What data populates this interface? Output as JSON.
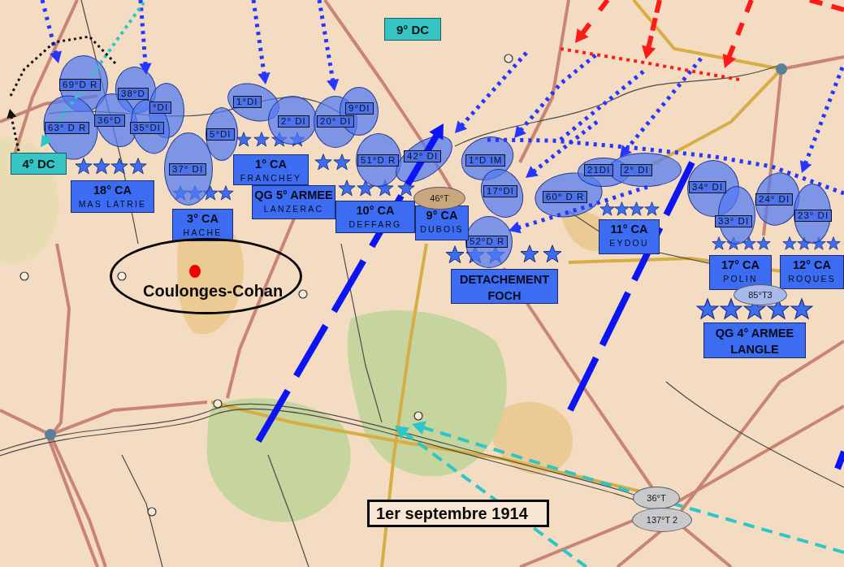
{
  "divisions": [
    "69°D R",
    "63° D R",
    "38°D",
    "36°D",
    "°DI",
    "35°DI",
    "5°DI",
    "37° DI",
    "1°DI",
    "2° DI",
    "20° DI",
    "9°DI",
    "51°D R",
    "42° DI",
    "1°D IM",
    "17°DI",
    "60° D R",
    "21DI",
    "2° DI",
    "34° DI",
    "33° DI",
    "24° DI",
    "23° DI",
    "52°D R"
  ],
  "cavalry": [
    "4° DC",
    "9° DC"
  ],
  "corps": [
    {
      "kind": "corps",
      "name": "18° CA",
      "commander": "MAS LATRIE"
    },
    {
      "kind": "corps",
      "name": "3° CA",
      "commander": "HACHE"
    },
    {
      "kind": "corps",
      "name": "1° CA",
      "commander": "FRANCHEY"
    },
    {
      "kind": "corps",
      "name": "QG 5° ARMEE",
      "commander": "LANZERAC"
    },
    {
      "kind": "corps",
      "name": "10° CA",
      "commander": "DEFFARG"
    },
    {
      "kind": "corps",
      "name": "9° CA",
      "commander": "DUBOIS"
    },
    {
      "kind": "command",
      "name": "DETACHEMENT",
      "commander": "FOCH"
    },
    {
      "kind": "corps",
      "name": "11° CA",
      "commander": "EYDOU"
    },
    {
      "kind": "corps",
      "name": "17° CA",
      "commander": "POLIN"
    },
    {
      "kind": "corps",
      "name": "12° CA",
      "commander": "ROQUES"
    },
    {
      "kind": "command",
      "name": "QG 4° ARMEE",
      "commander": "LANGLE"
    }
  ],
  "territorials": [
    {
      "label": "46°T",
      "color": "#c8a77c"
    },
    {
      "label": "85°T3",
      "color": "#a9b9ea"
    },
    {
      "label": "36°T",
      "color": "#c9c9cc"
    },
    {
      "label": "137°T 2",
      "color": "#c9c9cc"
    }
  ],
  "location": {
    "label": "Coulonges-Cohan"
  },
  "date": "1er septembre 1914"
}
